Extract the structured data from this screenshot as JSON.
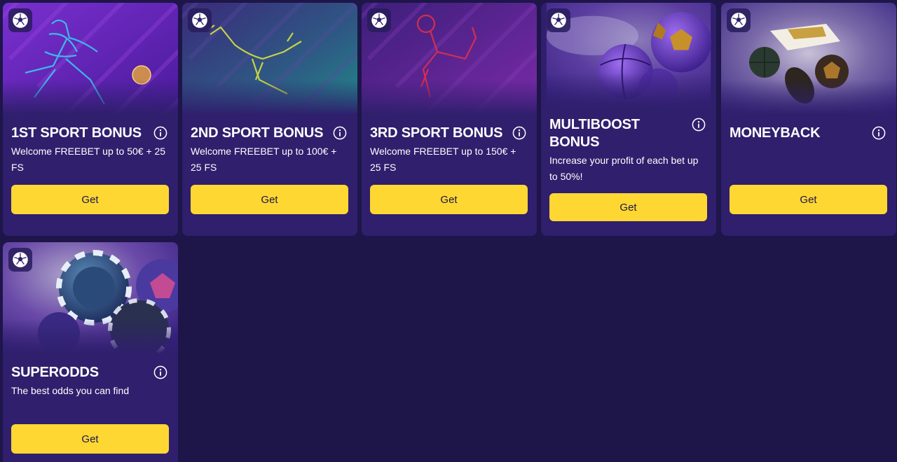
{
  "colors": {
    "page_background": "#1e1549",
    "card_background": "#2f1f6d",
    "button_background": "#ffd733",
    "button_text": "#1b1447",
    "text": "#ffffff"
  },
  "bonuses": [
    {
      "title": "1ST SPORT BONUS",
      "description": "Welcome FREEBET up to 50€ + 25 FS",
      "button_label": "Get",
      "badge_icon": "soccer-ball-icon",
      "info_icon": "info-icon"
    },
    {
      "title": "2ND SPORT BONUS",
      "description": "Welcome FREEBET up to 100€ + 25 FS",
      "button_label": "Get",
      "badge_icon": "soccer-ball-icon",
      "info_icon": "info-icon"
    },
    {
      "title": "3RD SPORT BONUS",
      "description": "Welcome FREEBET up to 150€ + 25 FS",
      "button_label": "Get",
      "badge_icon": "soccer-ball-icon",
      "info_icon": "info-icon"
    },
    {
      "title": "MULTIBOOST BONUS",
      "description": "Increase your profit of each bet up to 50%!",
      "button_label": "Get",
      "badge_icon": "soccer-ball-icon",
      "info_icon": "info-icon"
    },
    {
      "title": "MONEYBACK",
      "description": "",
      "button_label": "Get",
      "badge_icon": "soccer-ball-icon",
      "info_icon": "info-icon"
    },
    {
      "title": "SUPERODDS",
      "description": "The best odds you can find",
      "button_label": "Get",
      "badge_icon": "soccer-ball-icon",
      "info_icon": "info-icon"
    }
  ]
}
